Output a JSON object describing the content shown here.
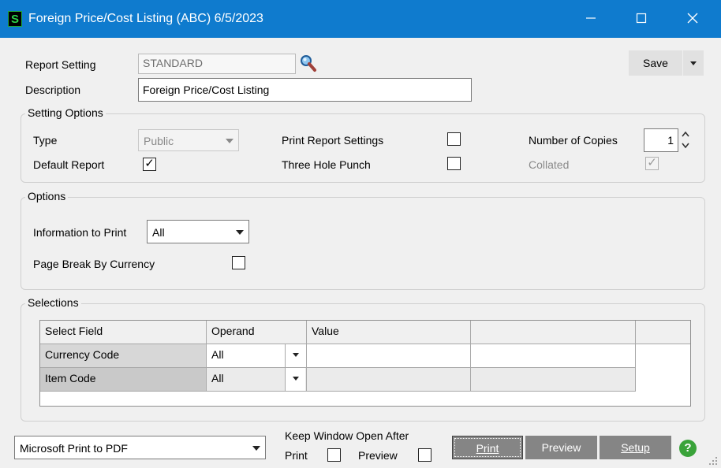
{
  "window": {
    "title": "Foreign Price/Cost Listing (ABC) 6/5/2023",
    "app_icon_letter": "S",
    "controls": [
      "minimize",
      "maximize",
      "close"
    ]
  },
  "report": {
    "setting_label": "Report Setting",
    "setting_value": "STANDARD",
    "description_label": "Description",
    "description_value": "Foreign Price/Cost Listing",
    "save_label": "Save"
  },
  "setting_options": {
    "title": "Setting Options",
    "type_label": "Type",
    "type_value": "Public",
    "default_report_label": "Default Report",
    "default_report_checked": true,
    "print_report_settings_label": "Print Report Settings",
    "three_hole_punch_label": "Three Hole Punch",
    "number_of_copies_label": "Number of Copies",
    "number_of_copies_value": "1",
    "collated_label": "Collated",
    "collated_checked": true
  },
  "options": {
    "title": "Options",
    "info_to_print_label": "Information to Print",
    "info_to_print_value": "All",
    "page_break_label": "Page Break By Currency"
  },
  "selections": {
    "title": "Selections",
    "columns": [
      "Select Field",
      "Operand",
      "Value",
      ""
    ],
    "rows": [
      {
        "field": "Currency Code",
        "operand": "All",
        "value": ""
      },
      {
        "field": "Item Code",
        "operand": "All",
        "value": ""
      }
    ]
  },
  "footer": {
    "printer_value": "Microsoft Print to PDF",
    "keep_open_label": "Keep Window Open After",
    "print_label": "Print",
    "preview_label": "Preview",
    "print_button": "Print",
    "preview_button": "Preview",
    "setup_button": "Setup",
    "help_icon": "?"
  },
  "colors": {
    "titlebar": "#0f7bce",
    "button_gray": "#858585",
    "help_green": "#3aa33a"
  }
}
